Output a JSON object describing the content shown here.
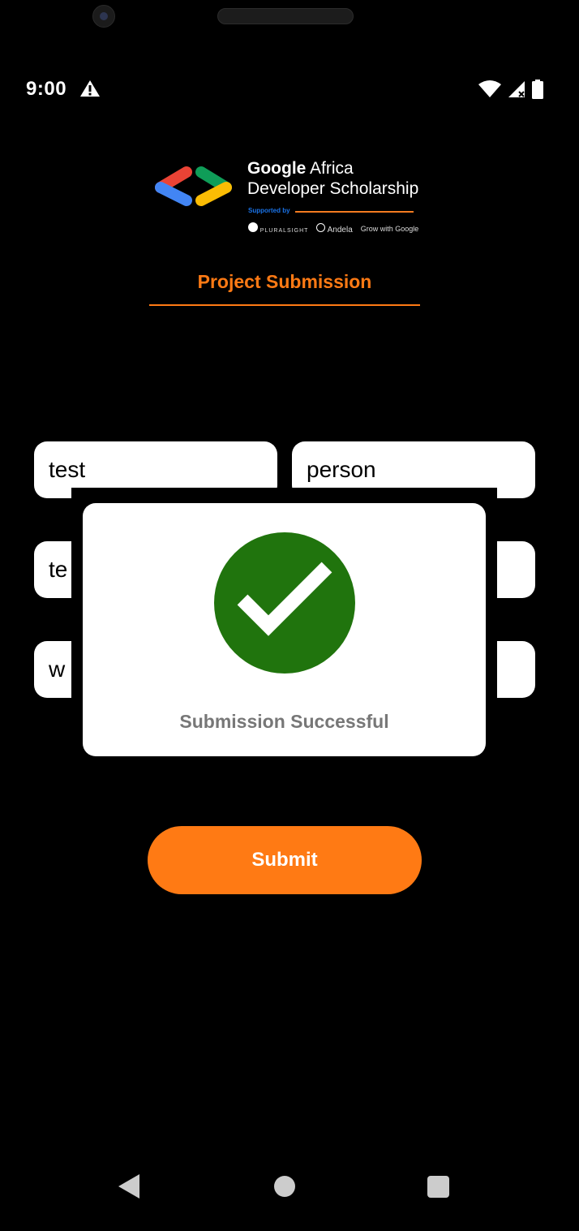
{
  "status_bar": {
    "time": "9:00"
  },
  "logo": {
    "line1_bold": "Google",
    "line1_rest": " Africa",
    "line2": "Developer Scholarship",
    "supported_by": "Supported by",
    "partners": [
      "PLURALSIGHT",
      "Andela",
      "Grow with Google"
    ]
  },
  "page": {
    "title": "Project Submission"
  },
  "form": {
    "first_name": "test",
    "last_name": "person",
    "email_partial": "te",
    "link_partial": "w"
  },
  "dialog": {
    "message": "Submission Successful"
  },
  "buttons": {
    "submit": "Submit"
  },
  "colors": {
    "accent": "#ff7a14",
    "success": "#20740d",
    "google_blue": "#4285f4",
    "google_red": "#ea4335",
    "google_green": "#0f9d58",
    "google_yellow": "#fbbc04"
  },
  "icons": {
    "status_warning": "warning-icon",
    "wifi": "wifi-icon",
    "signal": "signal-icon",
    "battery": "battery-icon",
    "success": "checkmark-circle-icon",
    "nav_back": "back-triangle-icon",
    "nav_home": "home-circle-icon",
    "nav_recent": "recent-square-icon"
  }
}
